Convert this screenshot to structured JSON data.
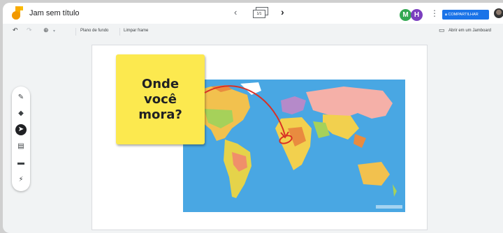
{
  "app": {
    "title": "Jam sem título"
  },
  "frame_nav": {
    "prev_icon": "chevron-left-icon",
    "indicator": "1/1",
    "next_icon": "chevron-right-icon"
  },
  "collaborators": [
    {
      "initial": "M",
      "color": "#34a853"
    },
    {
      "initial": "H",
      "color": "#7b3fbf"
    }
  ],
  "header": {
    "share_label": "COMPARTILHAR",
    "share_color": "#1a73e8"
  },
  "toolbar": {
    "background_label": "Plano de fundo",
    "clear_label": "Limpar frame",
    "open_label": "Abrir em um Jamboard"
  },
  "sticky_note": {
    "line1": "Onde",
    "line2": "você",
    "line3": "mora?",
    "color": "#fce94f"
  },
  "tools": [
    "pen-icon",
    "eraser-icon",
    "select-icon",
    "sticky-note-icon",
    "image-icon",
    "laser-icon"
  ],
  "annotation": {
    "color": "#d93025"
  }
}
